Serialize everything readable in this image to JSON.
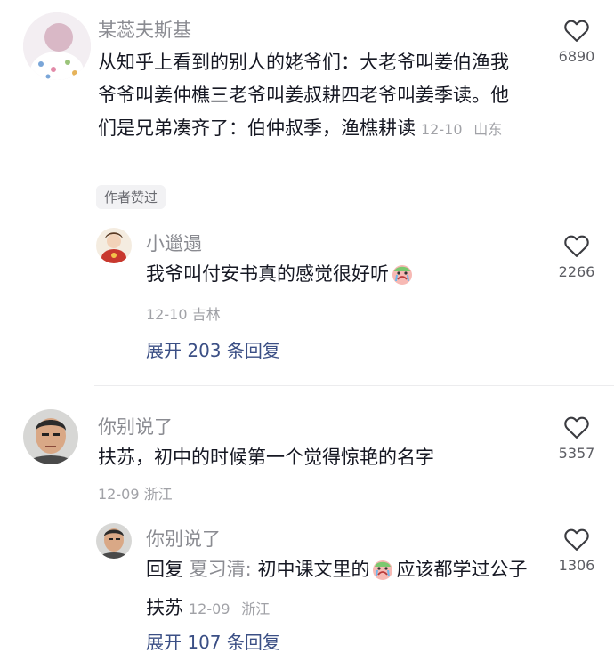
{
  "comments": [
    {
      "author": "某蕊夫斯基",
      "text": "从知乎上看到的别人的姥爷们：大老爷叫姜伯渔我爷爷叫姜仲樵三老爷叫姜叔耕四老爷叫姜季读。他们是兄弟凑齐了：伯仲叔季，渔樵耕读",
      "date": "12-10",
      "location": "山东",
      "likes": "6890",
      "badge": "作者赞过",
      "reply": {
        "author": "小邋遢",
        "text": "我爷叫付安书真的感觉很好听",
        "date": "12-10",
        "location": "吉林",
        "likes": "2266"
      },
      "expand": "展开 203 条回复"
    },
    {
      "author": "你别说了",
      "text": "扶苏，初中的时候第一个觉得惊艳的名字",
      "date": "12-09",
      "location": "浙江",
      "likes": "5357",
      "reply": {
        "author": "你别说了",
        "reply_prefix": "回复",
        "reply_to": "夏习清:",
        "text_before": "初中课文里的",
        "text_after": "应该都学过公子扶苏",
        "date": "12-09",
        "location": "浙江",
        "likes": "1306"
      },
      "expand": "展开 107 条回复"
    }
  ],
  "icons": {
    "like": "heart-outline-icon",
    "emoji": "crying-face-emoji"
  },
  "colors": {
    "link": "#3b4f85",
    "meta": "#a1a2a7",
    "author": "#8a8b91"
  }
}
